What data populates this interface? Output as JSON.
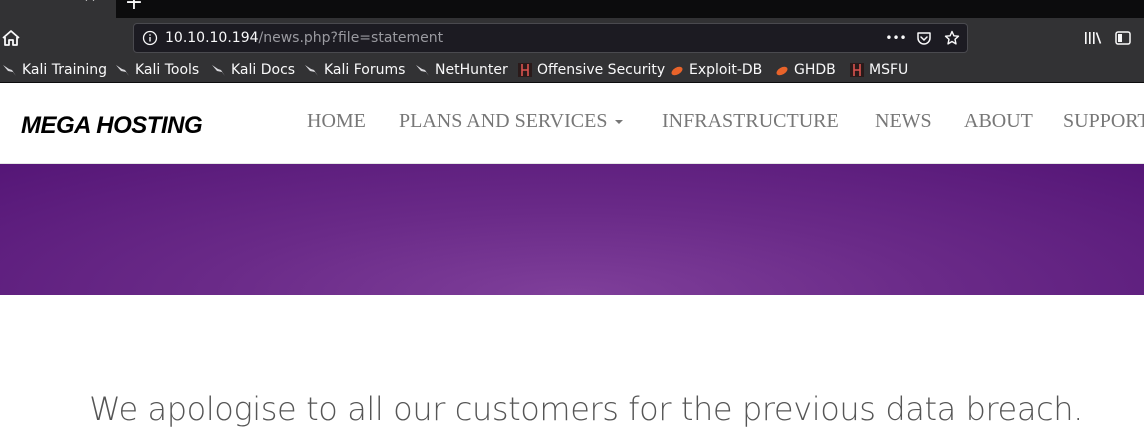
{
  "browser": {
    "tab_title": "ng",
    "tab_close_glyph": "✕",
    "new_tab_glyph": "+",
    "url_host": "10.10.10.194",
    "url_path": "/news.php?file=statement",
    "url_menu_glyph": "•••",
    "bookmarks": [
      {
        "label": "Kali Training",
        "icon": "kali-dragon-icon"
      },
      {
        "label": "Kali Tools",
        "icon": "kali-dragon-icon"
      },
      {
        "label": "Kali Docs",
        "icon": "kali-dragon-icon"
      },
      {
        "label": "Kali Forums",
        "icon": "kali-dragon-icon"
      },
      {
        "label": "NetHunter",
        "icon": "kali-dragon-icon"
      },
      {
        "label": "Offensive Security",
        "icon": "offsec-icon"
      },
      {
        "label": "Exploit-DB",
        "icon": "exploitdb-icon"
      },
      {
        "label": "GHDB",
        "icon": "exploitdb-icon"
      },
      {
        "label": "MSFU",
        "icon": "offsec-icon"
      }
    ]
  },
  "site": {
    "brand": "MEGA HOSTING",
    "nav": [
      {
        "label": "HOME"
      },
      {
        "label": "PLANS AND SERVICES",
        "dropdown": true
      },
      {
        "label": "INFRASTRUCTURE"
      },
      {
        "label": "NEWS"
      },
      {
        "label": "ABOUT"
      },
      {
        "label": "SUPPORT"
      }
    ],
    "hero_color": "#6a2a88",
    "statement": "We apologise to all our customers for the previous data breach."
  }
}
